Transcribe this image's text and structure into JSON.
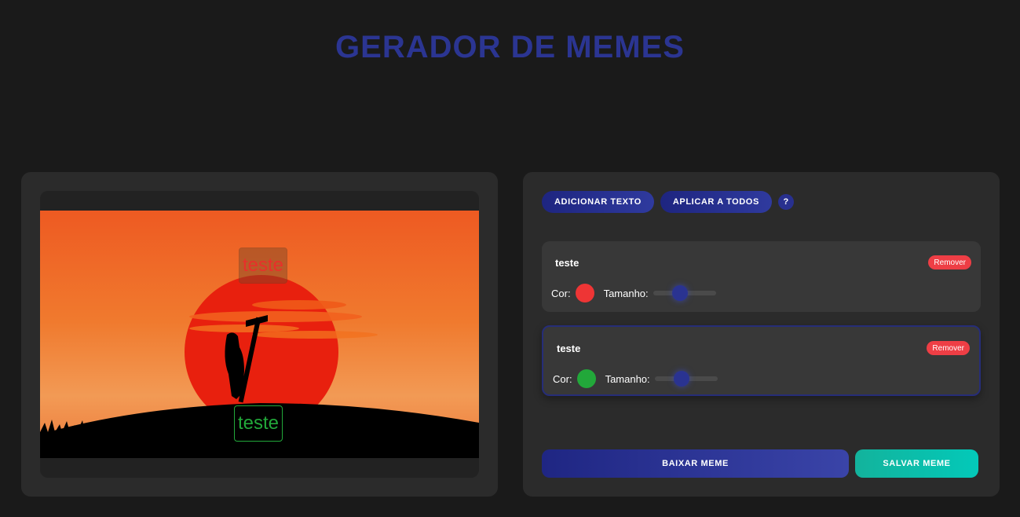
{
  "header": {
    "title": "GERADOR DE MEMES"
  },
  "canvas": {
    "texts": [
      {
        "text": "teste",
        "color": "#e8302a"
      },
      {
        "text": "teste",
        "color": "#22a83a"
      }
    ]
  },
  "toolbar": {
    "add_text_label": "ADICIONAR TEXTO",
    "apply_all_label": "APLICAR A TODOS",
    "help_label": "?"
  },
  "text_items": [
    {
      "name": "teste",
      "remove_label": "Remover",
      "color_label": "Cor:",
      "color": "#ee3535",
      "size_label": "Tamanho:",
      "size_fraction": 0.42
    },
    {
      "name": "teste",
      "remove_label": "Remover",
      "color_label": "Cor:",
      "color": "#22a83a",
      "size_label": "Tamanho:",
      "size_fraction": 0.42
    }
  ],
  "actions": {
    "download_label": "BAIXAR MEME",
    "save_label": "SALVAR MEME"
  },
  "colors": {
    "accent": "#2b3592",
    "danger": "#ee3e45",
    "teal": "#03c9b9"
  }
}
